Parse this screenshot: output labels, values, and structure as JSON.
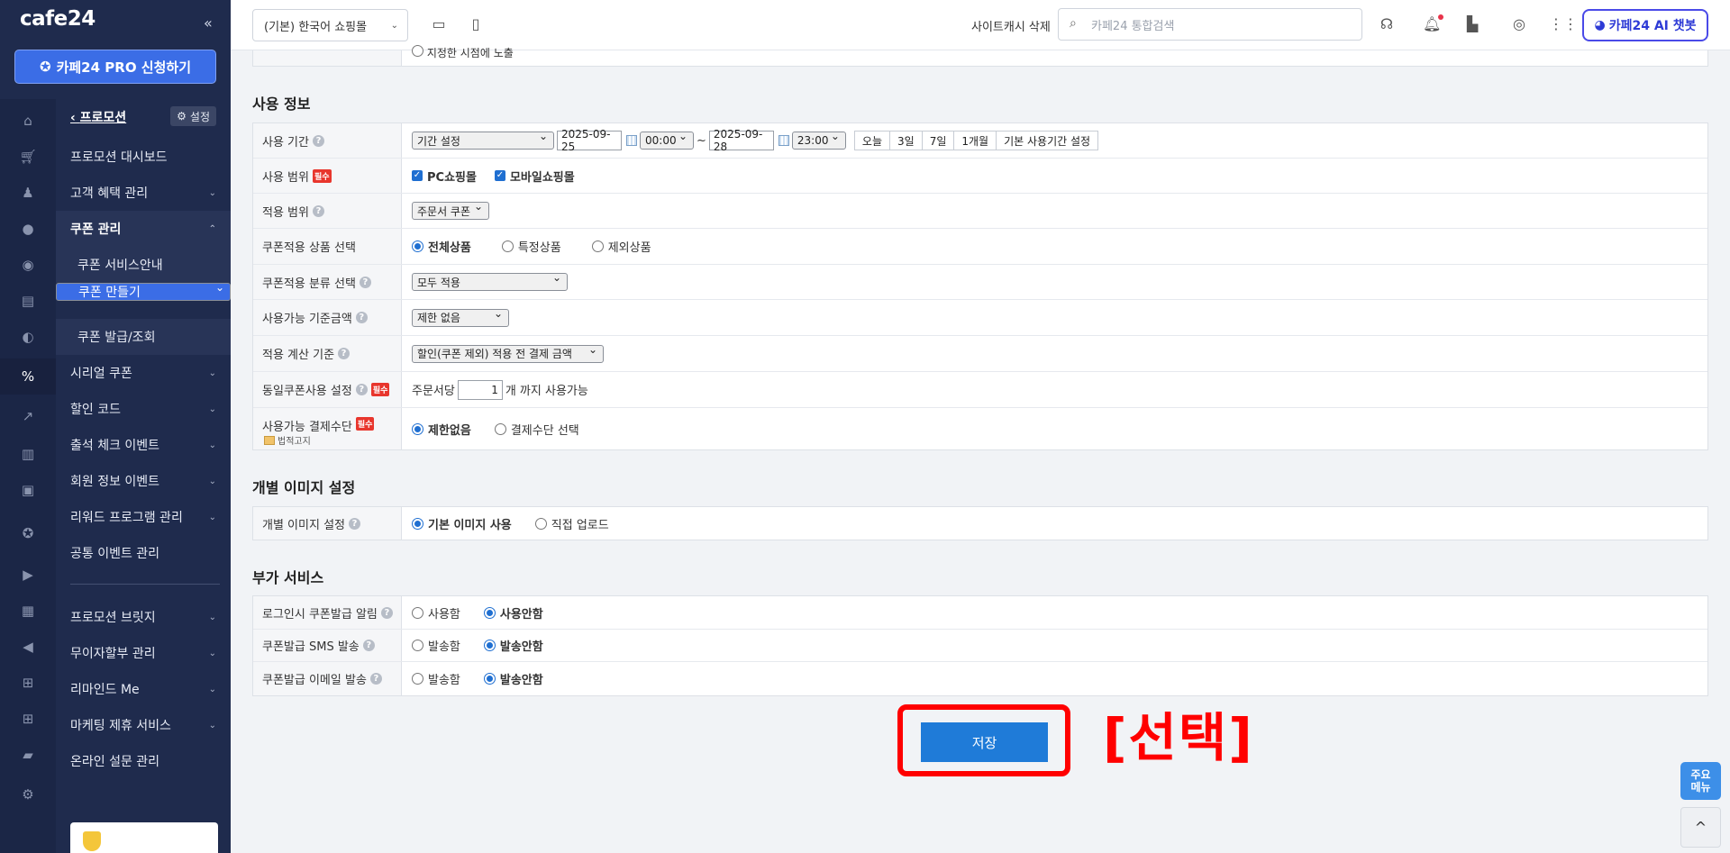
{
  "sidebar": {
    "logo": "cafe24",
    "collapse_icon": "«",
    "pro_button": "카페24 PRO 신청하기",
    "section_back": "프로모션",
    "settings": "설정",
    "items": [
      {
        "label": "프로모션 대시보드"
      },
      {
        "label": "고객 혜택 관리"
      },
      {
        "label": "쿠폰 관리"
      },
      {
        "label": "쿠폰 서비스안내"
      },
      {
        "label": "쿠폰 만들기"
      },
      {
        "label": "쿠폰 발급/조회"
      },
      {
        "label": "시리얼 쿠폰"
      },
      {
        "label": "할인 코드"
      },
      {
        "label": "출석 체크 이벤트"
      },
      {
        "label": "회원 정보 이벤트"
      },
      {
        "label": "리워드 프로그램 관리"
      },
      {
        "label": "공통 이벤트 관리"
      },
      {
        "label": "프로모션 브릿지"
      },
      {
        "label": "무이자할부 관리"
      },
      {
        "label": "리마인드 Me"
      },
      {
        "label": "마케팅 제휴 서비스"
      },
      {
        "label": "온라인 설문 관리"
      }
    ]
  },
  "topbar": {
    "shop_select": "(기본) 한국어 쇼핑몰",
    "cache_delete": "사이트캐시 삭제",
    "search_placeholder": "카페24 통합검색",
    "ai_chatbot": "카페24 AI 챗봇"
  },
  "fragment": {
    "text": "지정한 시점에 노출"
  },
  "usage_info": {
    "title": "사용 정보",
    "period_label": "사용 기간",
    "period_select": "기간 설정",
    "start_date": "2025-09-25",
    "start_time": "00:00",
    "tilde": "~",
    "end_date": "2025-09-28",
    "end_time": "23:00",
    "quick_buttons": [
      "오늘",
      "3일",
      "7일",
      "1개월",
      "기본 사용기간 설정"
    ],
    "scope_label": "사용 범위",
    "required_badge": "필수",
    "pc_mall": "PC쇼핑몰",
    "mobile_mall": "모바일쇼핑몰",
    "apply_scope_label": "적용 범위",
    "apply_scope_value": "주문서 쿠폰",
    "product_select_label": "쿠폰적용 상품 선택",
    "product_options": [
      "전체상품",
      "특정상품",
      "제외상품"
    ],
    "category_label": "쿠폰적용 분류 선택",
    "category_value": "모두 적용",
    "min_amount_label": "사용가능 기준금액",
    "min_amount_value": "제한 없음",
    "calc_label": "적용 계산 기준",
    "calc_value": "할인(쿠폰 제외) 적용 전 결제 금액",
    "same_coupon_label": "동일쿠폰사용 설정",
    "per_order": "주문서당",
    "same_coupon_count": "1",
    "same_coupon_suffix": "개 까지 사용가능",
    "payment_label": "사용가능 결제수단",
    "legal_notice": "법적고지",
    "payment_options": [
      "제한없음",
      "결제수단 선택"
    ]
  },
  "image_settings": {
    "title": "개별 이미지 설정",
    "label": "개별 이미지 설정",
    "options": [
      "기본 이미지 사용",
      "직접 업로드"
    ]
  },
  "extra_services": {
    "title": "부가 서비스",
    "login_alert_label": "로그인시 쿠폰발급 알림",
    "login_alert_options": [
      "사용함",
      "사용안함"
    ],
    "sms_label": "쿠폰발급 SMS 발송",
    "sms_options": [
      "발송함",
      "발송안함"
    ],
    "email_label": "쿠폰발급 이메일 발송",
    "email_options": [
      "발송함",
      "발송안함"
    ]
  },
  "actions": {
    "save": "저장",
    "select_annotation": "[선택]",
    "quick_menu": "주요\n메뉴",
    "to_top": "^"
  },
  "colors": {
    "sidebar_bg": "#1f2b4d",
    "accent": "#3b6de6",
    "save_button": "#1f7bd8",
    "annotation_red": "#ff0000"
  }
}
